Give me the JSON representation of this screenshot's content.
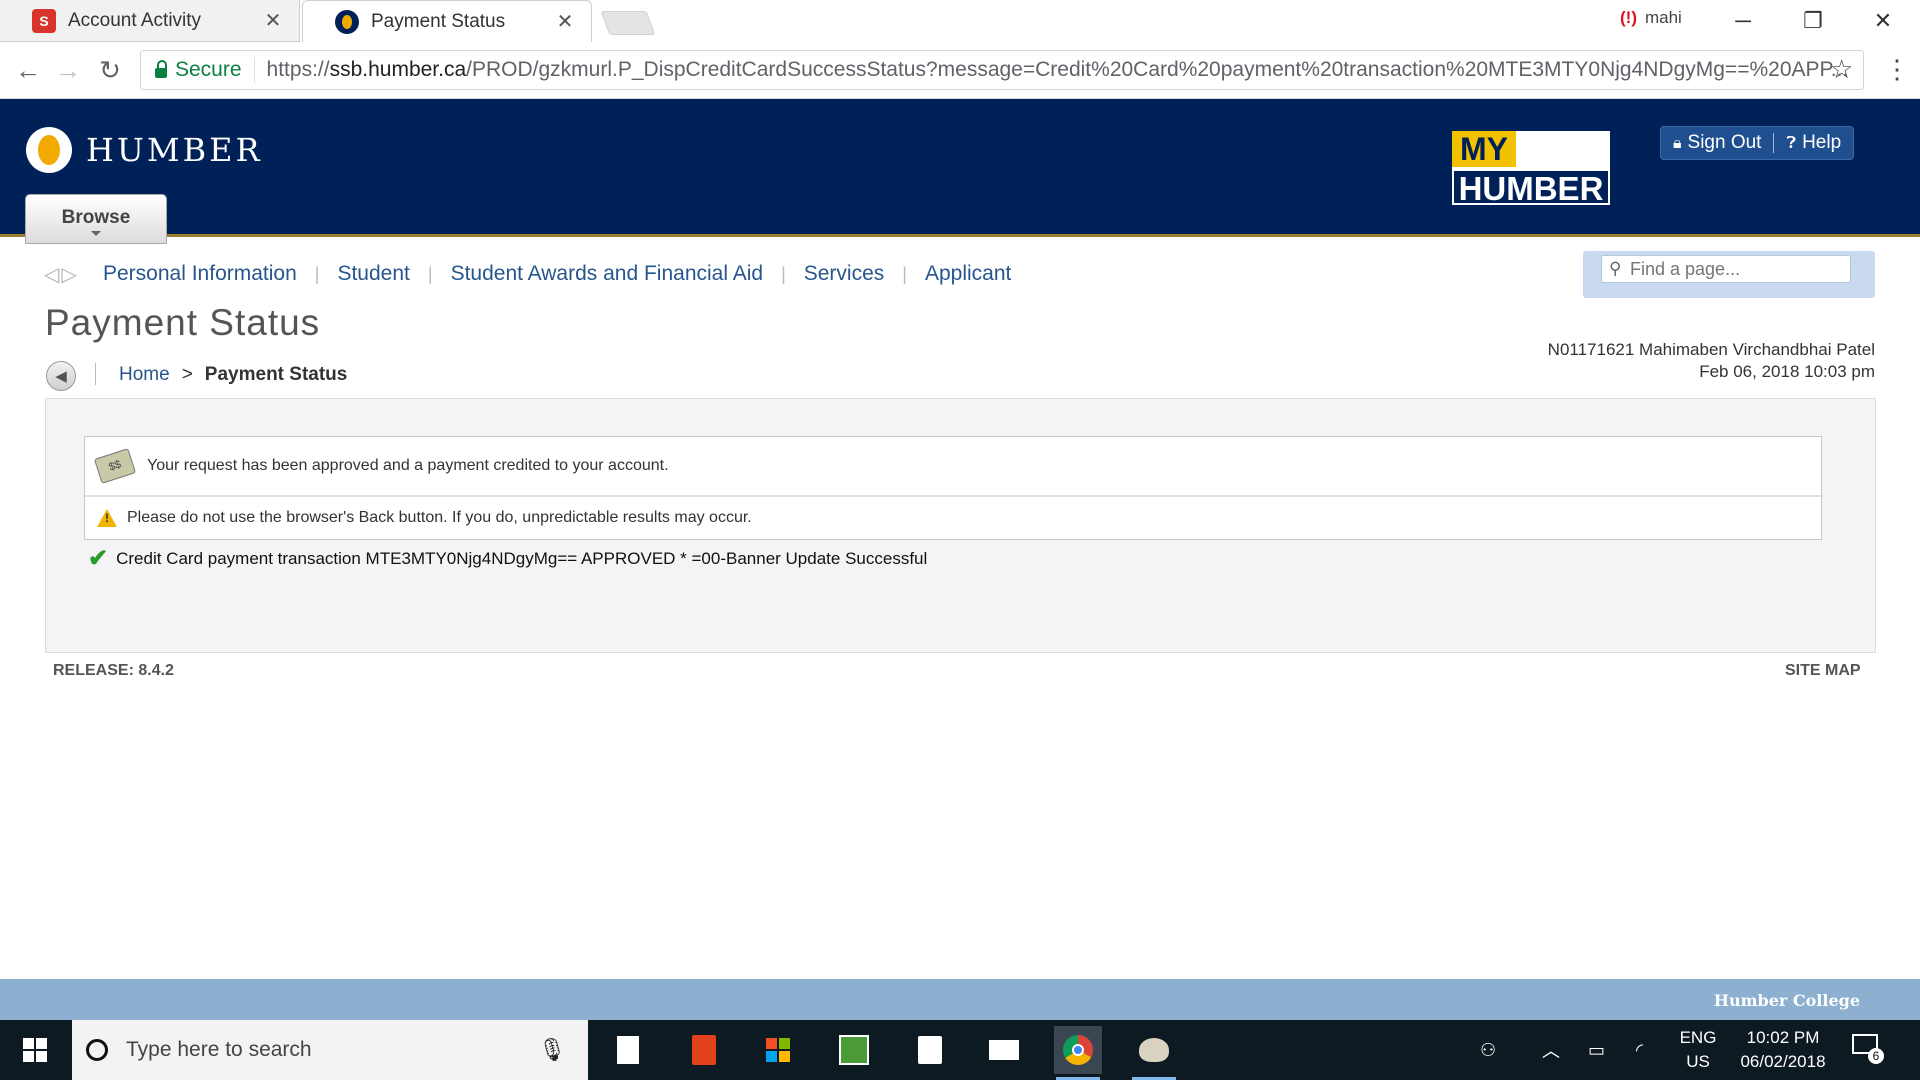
{
  "browser": {
    "tabs": [
      {
        "title": "Account Activity",
        "active": false
      },
      {
        "title": "Payment Status",
        "active": true
      }
    ],
    "profile_name": "mahi",
    "secure_label": "Secure",
    "url_scheme": "https://",
    "url_host": "ssb.humber.ca",
    "url_path": "/PROD/gzkmurl.P_DispCreditCardSuccessStatus?message=Credit%20Card%20payment%20transaction%20MTE3MTY0Njg4NDgyMg==%20APP..."
  },
  "header": {
    "brand": "HUMBER",
    "browse_label": "Browse",
    "my_humber_top": "MY",
    "my_humber_bottom": "HUMBER",
    "sign_out_label": "Sign Out",
    "help_label": "Help"
  },
  "menu": {
    "items": [
      "Personal Information",
      "Student",
      "Student Awards and Financial Aid",
      "Services",
      "Applicant"
    ],
    "find_placeholder": "Find a page..."
  },
  "page": {
    "title": "Payment Status",
    "user_line": "N01171621 Mahimaben Virchandbhai Patel",
    "datetime": "Feb 06, 2018 10:03 pm",
    "breadcrumb_home": "Home",
    "breadcrumb_sep": ">",
    "breadcrumb_current": "Payment Status"
  },
  "messages": {
    "approved": "Your request has been approved and a payment credited to your account.",
    "warning": "Please do not use the browser's Back button. If you do, unpredictable results may occur.",
    "success": "Credit Card payment transaction MTE3MTY0Njg4NDgyMg== APPROVED * =00-Banner Update Successful"
  },
  "footer": {
    "release": "RELEASE: 8.4.2",
    "site_map": "SITE MAP",
    "brand": "Humber College"
  },
  "taskbar": {
    "search_placeholder": "Type here to search",
    "lang_top": "ENG",
    "lang_bottom": "US",
    "time": "10:02 PM",
    "date": "06/02/2018",
    "notification_count": "6"
  },
  "colors": {
    "header_bg": "#002058",
    "accent_gold": "#f2c200",
    "link_blue": "#27568e",
    "secure_green": "#0b8043",
    "success_green": "#2a9a2a"
  }
}
